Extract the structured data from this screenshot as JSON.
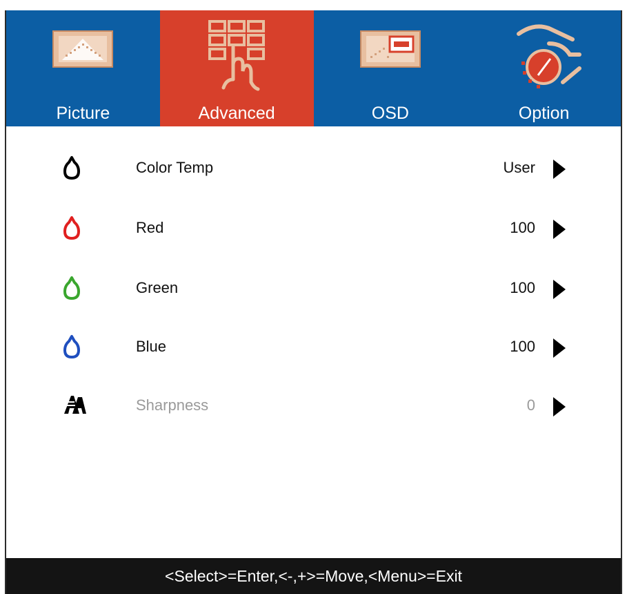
{
  "tabs": [
    {
      "label": "Picture",
      "icon": "picture-icon",
      "active": false
    },
    {
      "label": "Advanced",
      "icon": "advanced-touch-icon",
      "active": true
    },
    {
      "label": "OSD",
      "icon": "osd-icon",
      "active": false
    },
    {
      "label": "Option",
      "icon": "option-hand-dial-icon",
      "active": false
    }
  ],
  "rows": [
    {
      "label": "Color Temp",
      "value": "User",
      "icon": "drop-icon",
      "icon_color": "#000000",
      "enabled": true
    },
    {
      "label": "Red",
      "value": "100",
      "icon": "drop-icon",
      "icon_color": "#e02020",
      "enabled": true
    },
    {
      "label": "Green",
      "value": "100",
      "icon": "drop-icon",
      "icon_color": "#3aa62e",
      "enabled": true
    },
    {
      "label": "Blue",
      "value": "100",
      "icon": "drop-icon",
      "icon_color": "#1f4fbf",
      "enabled": true
    },
    {
      "label": "Sharpness",
      "value": "0",
      "icon": "sharpness-icon",
      "icon_color": "#000000",
      "enabled": false
    }
  ],
  "footer": {
    "hint": "<Select>=Enter,<-,+>=Move,<Menu>=Exit"
  },
  "colors": {
    "tabbar": "#0c5ea4",
    "active_tab": "#d7402b",
    "footer": "#141414",
    "disabled_text": "#9a9a9a"
  }
}
